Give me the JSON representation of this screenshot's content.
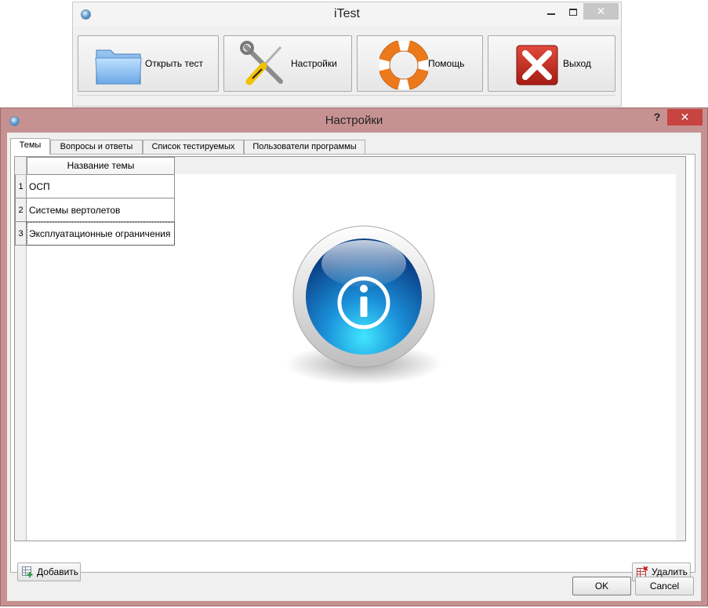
{
  "main_window": {
    "title": "iTest",
    "buttons": {
      "open_test": "Открыть тест",
      "settings": "Настройки",
      "help": "Помощь",
      "exit": "Выход"
    }
  },
  "settings_dialog": {
    "title": "Настройки",
    "help_glyph": "?",
    "tabs": [
      "Темы",
      "Вопросы и ответы",
      "Список тестируемых",
      "Пользователи программы"
    ],
    "active_tab": "Темы",
    "topics_table": {
      "column_header": "Название темы",
      "rows": [
        {
          "num": "1",
          "name": "ОСП"
        },
        {
          "num": "2",
          "name": "Системы вертолетов"
        },
        {
          "num": "3",
          "name": "Эксплуатационные ограничения"
        }
      ]
    },
    "add_button": "Добавить",
    "delete_button": "Удалить",
    "ok_button": "OK",
    "cancel_button": "Cancel"
  },
  "colors": {
    "dialog_frame": "#c69291",
    "close_button": "#c74440",
    "info_icon_blue": "#1a8fd8"
  },
  "icons": [
    "folder-icon",
    "tools-icon",
    "lifebuoy-icon",
    "exit-x-icon",
    "info-icon",
    "add-row-icon",
    "delete-row-icon"
  ]
}
